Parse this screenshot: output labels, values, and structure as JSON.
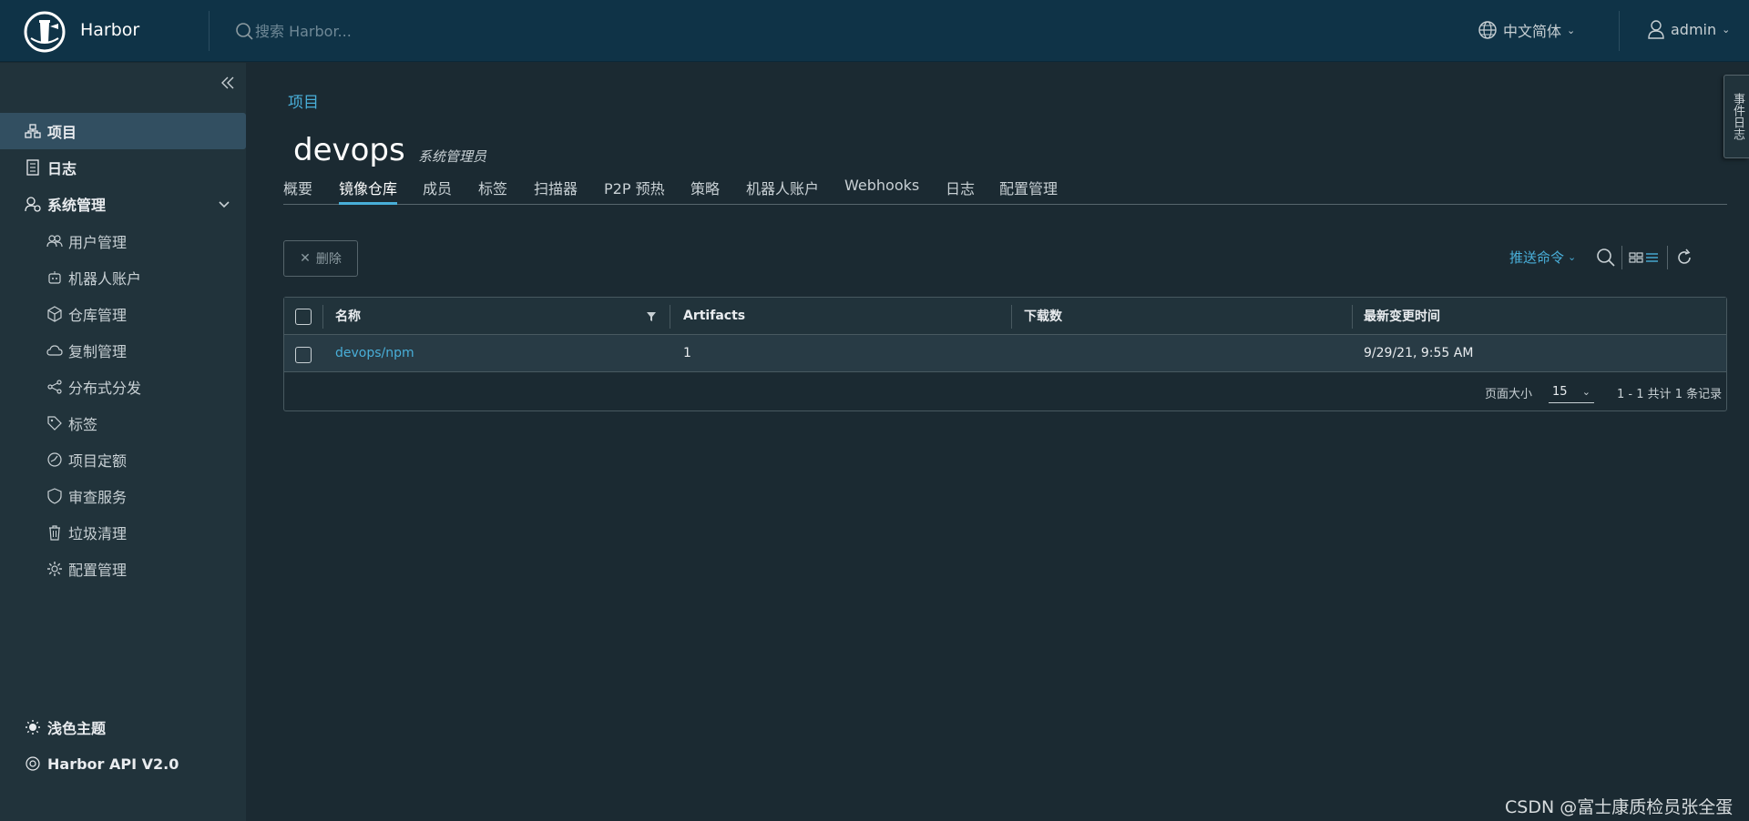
{
  "header": {
    "brand": "Harbor",
    "search_placeholder": "搜索 Harbor...",
    "language": "中文简体",
    "user": "admin"
  },
  "sidebar": {
    "items": [
      {
        "label": "项目",
        "icon": "projects-icon",
        "active": true
      },
      {
        "label": "日志",
        "icon": "logs-icon"
      },
      {
        "label": "系统管理",
        "icon": "admin-icon"
      }
    ],
    "subitems": [
      {
        "label": "用户管理",
        "icon": "users-icon"
      },
      {
        "label": "机器人账户",
        "icon": "robot-icon"
      },
      {
        "label": "仓库管理",
        "icon": "registry-icon"
      },
      {
        "label": "复制管理",
        "icon": "cloud-icon"
      },
      {
        "label": "分布式分发",
        "icon": "share-icon"
      },
      {
        "label": "标签",
        "icon": "tag-icon"
      },
      {
        "label": "项目定额",
        "icon": "gauge-icon"
      },
      {
        "label": "审查服务",
        "icon": "shield-icon"
      },
      {
        "label": "垃圾清理",
        "icon": "trash-icon"
      },
      {
        "label": "配置管理",
        "icon": "gear-icon"
      }
    ],
    "theme": "浅色主题",
    "api": "Harbor API V2.0"
  },
  "main": {
    "breadcrumb": "项目",
    "title": "devops",
    "role": "系统管理员",
    "tabs": [
      {
        "label": "概要"
      },
      {
        "label": "镜像仓库",
        "active": true
      },
      {
        "label": "成员"
      },
      {
        "label": "标签"
      },
      {
        "label": "扫描器"
      },
      {
        "label": "P2P 预热"
      },
      {
        "label": "策略"
      },
      {
        "label": "机器人账户"
      },
      {
        "label": "Webhooks"
      },
      {
        "label": "日志"
      },
      {
        "label": "配置管理"
      }
    ],
    "delete_label": "删除",
    "push_command": "推送命令"
  },
  "grid": {
    "columns": [
      "名称",
      "Artifacts",
      "下载数",
      "最新变更时间"
    ],
    "rows": [
      {
        "name": "devops/npm",
        "artifacts": "1",
        "downloads": "",
        "updated": "9/29/21, 9:55 AM"
      }
    ],
    "footer": {
      "page_size_label": "页面大小",
      "page_size": "15",
      "summary": "1 - 1 共计 1 条记录"
    }
  },
  "event_log": "事件日志",
  "watermark": "CSDN @富士康质检员张全蛋",
  "colors": {
    "accent": "#49afd9",
    "header_bg": "#0f3347",
    "sidebar_bg": "#21333b",
    "page_bg": "#1b2a32"
  }
}
